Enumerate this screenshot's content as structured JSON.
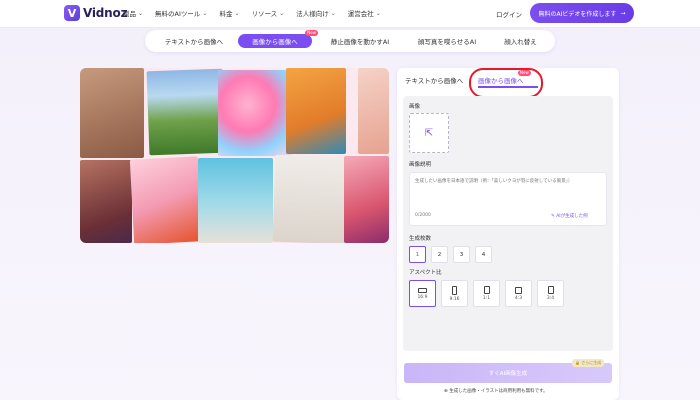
{
  "brand": {
    "logo_letter": "V",
    "name": "Vidnoz"
  },
  "nav": {
    "items": [
      {
        "label": "製品"
      },
      {
        "label": "無料のAIツール"
      },
      {
        "label": "料金"
      },
      {
        "label": "リソース"
      },
      {
        "label": "法人様向け"
      },
      {
        "label": "運営会社"
      }
    ],
    "chevron": "⌄",
    "login": "ログイン",
    "cta": "無料のAIビデオを作成します",
    "cta_arrow": "→"
  },
  "tabs": [
    {
      "label": "テキストから画像へ"
    },
    {
      "label": "画像から画像へ",
      "badge": "New"
    },
    {
      "label": "静止画像を動かすAI"
    },
    {
      "label": "顔写真を喋らせるAI"
    },
    {
      "label": "顔入れ替え"
    }
  ],
  "panel": {
    "tab_text_to_image": "テキストから画像へ",
    "tab_image_to_image": "画像から画像へ",
    "tab_badge": "New",
    "image_label": "画像",
    "upload_icon": "⇱",
    "desc_label": "画像説明",
    "desc_placeholder": "生成したい画像を日本語で説明（例：「美しいクヨが羽に反射している風景」）",
    "counter": "0/2000",
    "ai_write": "✎ AIが生成した例",
    "count_label": "生成枚数",
    "counts": [
      "1",
      "2",
      "3",
      "4"
    ],
    "ratio_label": "アスペクト比",
    "ratios": [
      "16:9",
      "9:16",
      "1:1",
      "4:3",
      "3:4"
    ],
    "generate": "すぐAI画像生成",
    "free_tag": "🔒 さらに生成",
    "note": "⊕ 生成した画像・イラストは商用利用も無料です。"
  },
  "colors": {
    "accent": "#7a4ef0",
    "highlight_circle": "#e8182b",
    "badge": "#ff4f7a"
  }
}
